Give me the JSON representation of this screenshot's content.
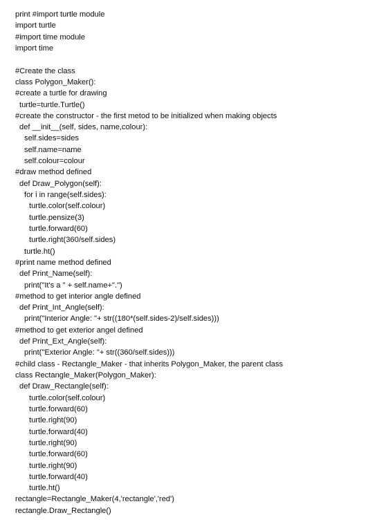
{
  "page": {
    "background_color": "#ffffff",
    "text_color": "#0d0d0d",
    "document_type": "code-listing",
    "language": "python"
  },
  "code": {
    "lines": [
      {
        "indent": 0,
        "text": "print #import turtle module"
      },
      {
        "indent": 0,
        "text": "import turtle"
      },
      {
        "indent": 0,
        "text": "#import time module"
      },
      {
        "indent": 0,
        "text": "import time"
      },
      {
        "indent": 0,
        "text": ""
      },
      {
        "indent": 0,
        "text": "#Create the class"
      },
      {
        "indent": 0,
        "text": "class Polygon_Maker():"
      },
      {
        "indent": 0,
        "text": "#create a turtle for drawing"
      },
      {
        "indent": 1,
        "text": "turtle=turtle.Turtle()"
      },
      {
        "indent": 0,
        "text": "#create the constructor - the first metod to be initialized when making objects"
      },
      {
        "indent": 1,
        "text": "def __init__(self, sides, name,colour):"
      },
      {
        "indent": 2,
        "text": "self.sides=sides"
      },
      {
        "indent": 2,
        "text": "self.name=name"
      },
      {
        "indent": 2,
        "text": "self.colour=colour"
      },
      {
        "indent": 0,
        "text": "#draw method defined"
      },
      {
        "indent": 1,
        "text": "def Draw_Polygon(self):"
      },
      {
        "indent": 2,
        "text": "for i in range(self.sides):"
      },
      {
        "indent": 3,
        "text": "turtle.color(self.colour)"
      },
      {
        "indent": 3,
        "text": "turtle.pensize(3)"
      },
      {
        "indent": 3,
        "text": "turtle.forward(60)"
      },
      {
        "indent": 3,
        "text": "turtle.right(360/self.sides)"
      },
      {
        "indent": 2,
        "text": "turtle.ht()"
      },
      {
        "indent": 0,
        "text": "#print name method defined"
      },
      {
        "indent": 1,
        "text": "def Print_Name(self):"
      },
      {
        "indent": 2,
        "text": "print(\"It's a \" + self.name+\".\")"
      },
      {
        "indent": 0,
        "text": "#method to get interior angle defined"
      },
      {
        "indent": 1,
        "text": "def Print_Int_Angle(self):"
      },
      {
        "indent": 2,
        "text": "print(\"Interior Angle: \"+ str((180*(self.sides-2)/self.sides)))"
      },
      {
        "indent": 0,
        "text": "#method to get exterior angel defined"
      },
      {
        "indent": 1,
        "text": "def Print_Ext_Angle(self):"
      },
      {
        "indent": 2,
        "text": "print(\"Exterior Angle: \"+ str((360/self.sides)))"
      },
      {
        "indent": 0,
        "text": "#child class - Rectangle_Maker - that inherits Polygon_Maker, the parent class"
      },
      {
        "indent": 0,
        "text": "class Rectangle_Maker(Polygon_Maker):"
      },
      {
        "indent": 1,
        "text": "def Draw_Rectangle(self):"
      },
      {
        "indent": 3,
        "text": "turtle.color(self.colour)"
      },
      {
        "indent": 3,
        "text": "turtle.forward(60)"
      },
      {
        "indent": 3,
        "text": "turtle.right(90)"
      },
      {
        "indent": 3,
        "text": "turtle.forward(40)"
      },
      {
        "indent": 3,
        "text": "turtle.right(90)"
      },
      {
        "indent": 3,
        "text": "turtle.forward(60)"
      },
      {
        "indent": 3,
        "text": "turtle.right(90)"
      },
      {
        "indent": 3,
        "text": "turtle.forward(40)"
      },
      {
        "indent": 3,
        "text": "turtle.ht()"
      },
      {
        "indent": 0,
        "text": "rectangle=Rectangle_Maker(4,'rectangle','red')"
      },
      {
        "indent": 0,
        "text": "rectangle.Draw_Rectangle()"
      }
    ]
  }
}
